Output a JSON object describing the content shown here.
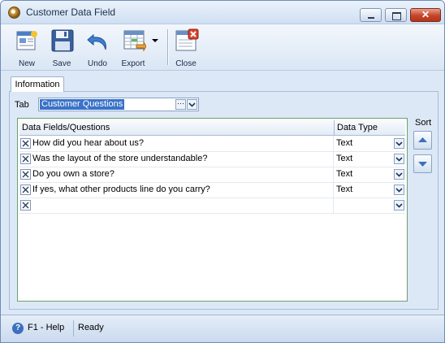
{
  "window": {
    "title": "Customer Data Field",
    "close_glyph": "✕"
  },
  "toolbar": {
    "buttons": [
      {
        "label": "New",
        "icon": "new-document-icon"
      },
      {
        "label": "Save",
        "icon": "floppy-disk-icon"
      },
      {
        "label": "Undo",
        "icon": "undo-arrow-icon"
      },
      {
        "label": "Export",
        "icon": "export-spreadsheet-icon"
      },
      {
        "label": "Close",
        "icon": "close-form-icon"
      }
    ]
  },
  "tabs": [
    {
      "label": "Information",
      "active": true
    }
  ],
  "form": {
    "tab_label": "Tab",
    "tab_value": "Customer Questions"
  },
  "grid": {
    "columns": [
      "Data Fields/Questions",
      "Data Type"
    ],
    "rows": [
      {
        "question": "How did you hear about us?",
        "type": "Text"
      },
      {
        "question": "Was the layout of the store understandable?",
        "type": "Text"
      },
      {
        "question": "Do you own a store?",
        "type": "Text"
      },
      {
        "question": "If yes, what other products line do you carry?",
        "type": "Text"
      },
      {
        "question": "",
        "type": ""
      }
    ]
  },
  "sort": {
    "label": "Sort"
  },
  "status": {
    "help": "F1 - Help",
    "text": "Ready"
  },
  "colors": {
    "accent": "#3a73c8",
    "window_bg": "#dce8f6",
    "grid_border": "#6da06d"
  }
}
